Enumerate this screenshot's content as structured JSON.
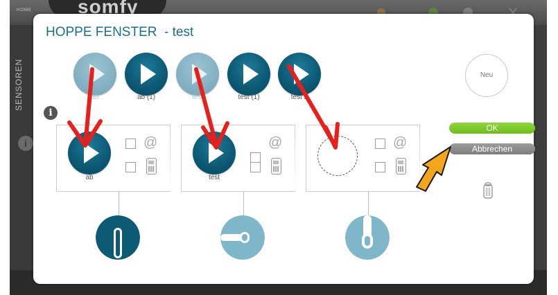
{
  "app": {
    "home_label": "HOME",
    "brand": "somfy",
    "sidebar_label": "SENSOREN"
  },
  "dialog": {
    "title": "HOPPE FENSTER  - test",
    "new_button_label": "Neu",
    "ok_label": "OK",
    "cancel_label": "Abbrechen"
  },
  "scenarios": [
    {
      "label": "ab",
      "state": "dragged"
    },
    {
      "label": "ab (1)",
      "state": "available"
    },
    {
      "label": "test",
      "state": "dragged"
    },
    {
      "label": "test (1)",
      "state": "available"
    },
    {
      "label": "test 2",
      "state": "available"
    }
  ],
  "slots": [
    {
      "scenario_label": "ab",
      "handle_position": "down"
    },
    {
      "scenario_label": "test",
      "handle_position": "horizontal"
    },
    {
      "scenario_label": "",
      "handle_position": "up"
    }
  ],
  "colors": {
    "title": "#1c6f8c",
    "play_button": "#0d5a75",
    "ok_button": "#7ac82a",
    "cancel_button": "#8a8a8a",
    "arrow_red": "#e8201c",
    "arrow_pointer": "#f5a51c"
  },
  "icons": {
    "info": "info-icon",
    "email": "at-sign-icon",
    "sms": "mobile-phone-icon",
    "delete": "trash-icon"
  }
}
